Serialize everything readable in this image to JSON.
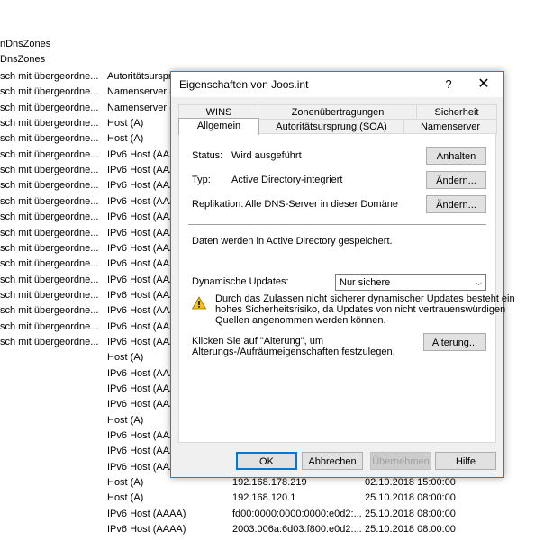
{
  "background": {
    "top_lines": [
      "nDnsZones",
      "DnsZones"
    ],
    "rows": [
      {
        "c1": "sch mit übergeordne...",
        "c2": "Autoritätsursprung (SOA)",
        "c3": "",
        "c4": ""
      },
      {
        "c1": "sch mit übergeordne...",
        "c2": "Namenserver (NS)",
        "c3": "",
        "c4": ""
      },
      {
        "c1": "sch mit übergeordne...",
        "c2": "Namenserver (NS)",
        "c3": "",
        "c4": ""
      },
      {
        "c1": "sch mit übergeordne...",
        "c2": "Host (A)",
        "c3": "",
        "c4": ""
      },
      {
        "c1": "sch mit übergeordne...",
        "c2": "Host (A)",
        "c3": "",
        "c4": ""
      },
      {
        "c1": "sch mit übergeordne...",
        "c2": "IPv6 Host (AAAA)",
        "c3": "",
        "c4": ""
      },
      {
        "c1": "sch mit übergeordne...",
        "c2": "IPv6 Host (AAAA)",
        "c3": "",
        "c4": ""
      },
      {
        "c1": "sch mit übergeordne...",
        "c2": "IPv6 Host (AAAA)",
        "c3": "",
        "c4": ""
      },
      {
        "c1": "sch mit übergeordne...",
        "c2": "IPv6 Host (AAAA)",
        "c3": "",
        "c4": ""
      },
      {
        "c1": "sch mit übergeordne...",
        "c2": "IPv6 Host (AAAA)",
        "c3": "",
        "c4": ""
      },
      {
        "c1": "sch mit übergeordne...",
        "c2": "IPv6 Host (AAAA)",
        "c3": "",
        "c4": ""
      },
      {
        "c1": "sch mit übergeordne...",
        "c2": "IPv6 Host (AAAA)",
        "c3": "",
        "c4": ""
      },
      {
        "c1": "sch mit übergeordne...",
        "c2": "IPv6 Host (AAAA)",
        "c3": "",
        "c4": ""
      },
      {
        "c1": "sch mit übergeordne...",
        "c2": "IPv6 Host (AAAA)",
        "c3": "",
        "c4": ""
      },
      {
        "c1": "sch mit übergeordne...",
        "c2": "IPv6 Host (AAAA)",
        "c3": "",
        "c4": ""
      },
      {
        "c1": "sch mit übergeordne...",
        "c2": "IPv6 Host (AAAA)",
        "c3": "",
        "c4": ""
      },
      {
        "c1": "sch mit übergeordne...",
        "c2": "IPv6 Host (AAAA)",
        "c3": "",
        "c4": ""
      },
      {
        "c1": "sch mit übergeordne...",
        "c2": "IPv6 Host (AAAA)",
        "c3": "",
        "c4": ""
      },
      {
        "c1": "",
        "c2": "Host (A)",
        "c3": "",
        "c4": ""
      },
      {
        "c1": "",
        "c2": "IPv6 Host (AAAA)",
        "c3": "",
        "c4": ""
      },
      {
        "c1": "",
        "c2": "IPv6 Host (AAAA)",
        "c3": "",
        "c4": ""
      },
      {
        "c1": "",
        "c2": "IPv6 Host (AAAA)",
        "c3": "",
        "c4": ""
      },
      {
        "c1": "",
        "c2": "Host (A)",
        "c3": "",
        "c4": ""
      },
      {
        "c1": "",
        "c2": "IPv6 Host (AAAA)",
        "c3": "",
        "c4": ""
      },
      {
        "c1": "",
        "c2": "IPv6 Host (AAAA)",
        "c3": "",
        "c4": ""
      },
      {
        "c1": "",
        "c2": "IPv6 Host (AAAA)",
        "c3": "",
        "c4": ""
      },
      {
        "c1": "",
        "c2": "Host (A)",
        "c3": "192.168.178.219",
        "c4": "02.10.2018 15:00:00"
      },
      {
        "c1": "",
        "c2": "Host (A)",
        "c3": "192.168.120.1",
        "c4": "25.10.2018 08:00:00"
      },
      {
        "c1": "",
        "c2": "IPv6 Host (AAAA)",
        "c3": "fd00:0000:0000:0000:e0d2:...",
        "c4": "25.10.2018 08:00:00"
      },
      {
        "c1": "",
        "c2": "IPv6 Host (AAAA)",
        "c3": "2003:006a:6d03:f800:e0d2:...",
        "c4": "25.10.2018 08:00:00"
      }
    ]
  },
  "dialog": {
    "title": "Eigenschaften von Joos.int",
    "help_glyph": "?",
    "close_glyph": "✕",
    "tabs_back": [
      "WINS",
      "Zonenübertragungen",
      "Sicherheit"
    ],
    "tabs_front": [
      "Allgemein",
      "Autoritätsursprung (SOA)",
      "Namenserver"
    ],
    "active_tab": "Allgemein",
    "status_label": "Status:",
    "status_value": "Wird ausgeführt",
    "status_button": "Anhalten",
    "type_label": "Typ:",
    "type_value": "Active Directory-integriert",
    "type_button": "Ändern...",
    "replication_label": "Replikation:",
    "replication_value": "Alle DNS-Server in dieser Domäne",
    "replication_button": "Ändern...",
    "stored_text": "Daten werden in Active Directory gespeichert.",
    "dynamic_label": "Dynamische Updates:",
    "dynamic_value": "Nur sichere",
    "warning_line1": "Durch das Zulassen nicht sicherer dynamischer Updates besteht ein",
    "warning_line2": "hohes Sicherheitsrisiko, da Updates von nicht vertrauenswürdigen",
    "warning_line3": "Quellen angenommen werden können.",
    "aging_line1": "Klicken Sie auf \"Alterung\", um",
    "aging_line2": "Alterungs-/Aufräumeigenschaften festzulegen.",
    "aging_button": "Alterung...",
    "ok": "OK",
    "cancel": "Abbrechen",
    "apply": "Übernehmen",
    "help": "Hilfe"
  },
  "colors": {
    "accent": "#0078d7",
    "dialog_border": "#1883d7",
    "warning": "#f5c400"
  }
}
